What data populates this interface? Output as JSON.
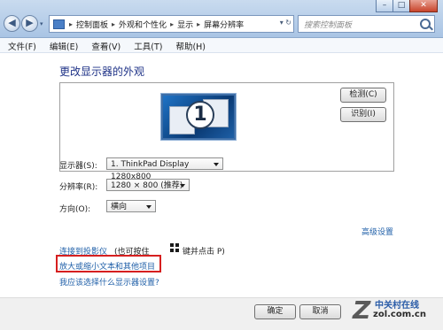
{
  "window": {
    "controls": {
      "minimize": "–",
      "maximize": "□",
      "close": "✕"
    }
  },
  "address_bar": {
    "back_glyph": "◀",
    "forward_glyph": "▶",
    "history_glyph": "▾",
    "crumbs": [
      "控制面板",
      "外观和个性化",
      "显示",
      "屏幕分辨率"
    ],
    "tools_glyph": "▾ ↻",
    "search_placeholder": "搜索控制面板"
  },
  "menu": [
    "文件(F)",
    "编辑(E)",
    "查看(V)",
    "工具(T)",
    "帮助(H)"
  ],
  "page": {
    "title": "更改显示器的外观",
    "monitor_number": "1",
    "detect_button": "检测(C)",
    "identify_button": "识别(I)",
    "display_label": "显示器(S):",
    "display_value": "1. ThinkPad Display 1280x800",
    "resolution_label": "分辨率(R):",
    "resolution_value": "1280 × 800 (推荐)",
    "orientation_label": "方向(O):",
    "orientation_value": "横向",
    "advanced_link": "高级设置",
    "projector_link": "连接到投影仪",
    "projector_hint_1": "(也可按住",
    "projector_hint_2": "键并点击 P)",
    "text_size_link": "放大或缩小文本和其他项目",
    "help_link": "我应该选择什么显示器设置?"
  },
  "footer": {
    "ok_button": "确定",
    "cancel_button": "取消"
  },
  "watermark": {
    "brand_cn": "中关村在线",
    "brand_url": "zol.com.cn",
    "letter": "Z"
  },
  "colors": {
    "highlight_box": "#d61f1f",
    "link": "#1f5fa8",
    "title": "#1e3287"
  }
}
